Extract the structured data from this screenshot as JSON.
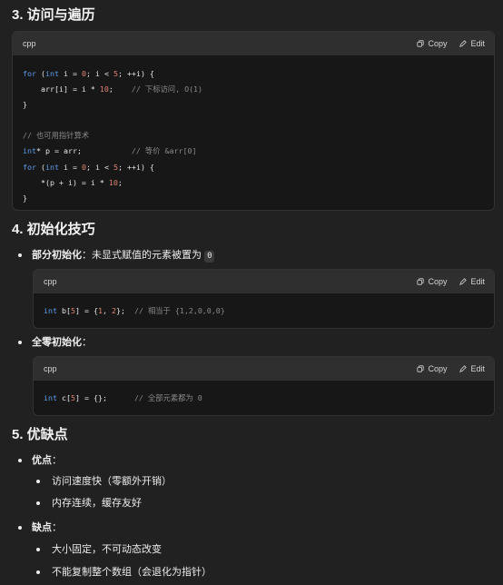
{
  "sections": {
    "access": {
      "heading": "3. 访问与遍历",
      "code": {
        "lang": "cpp",
        "copy_label": "Copy",
        "edit_label": "Edit",
        "lines": [
          [
            {
              "t": "kw",
              "s": "for"
            },
            {
              "t": "pl",
              "s": " ("
            },
            {
              "t": "kw",
              "s": "int"
            },
            {
              "t": "pl",
              "s": " i = "
            },
            {
              "t": "num",
              "s": "0"
            },
            {
              "t": "pl",
              "s": "; i < "
            },
            {
              "t": "num",
              "s": "5"
            },
            {
              "t": "pl",
              "s": "; ++i) {"
            }
          ],
          [
            {
              "t": "pl",
              "s": "    arr[i] = i * "
            },
            {
              "t": "num",
              "s": "10"
            },
            {
              "t": "pl",
              "s": ";    "
            },
            {
              "t": "cm",
              "s": "// 下标访问, O(1)"
            }
          ],
          [
            {
              "t": "pl",
              "s": "}"
            }
          ],
          [
            {
              "t": "pl",
              "s": ""
            }
          ],
          [
            {
              "t": "cm",
              "s": "// 也可用指针算术"
            }
          ],
          [
            {
              "t": "kw",
              "s": "int"
            },
            {
              "t": "pl",
              "s": "* p = arr;           "
            },
            {
              "t": "cm",
              "s": "// 等价 &arr[0]"
            }
          ],
          [
            {
              "t": "kw",
              "s": "for"
            },
            {
              "t": "pl",
              "s": " ("
            },
            {
              "t": "kw",
              "s": "int"
            },
            {
              "t": "pl",
              "s": " i = "
            },
            {
              "t": "num",
              "s": "0"
            },
            {
              "t": "pl",
              "s": "; i < "
            },
            {
              "t": "num",
              "s": "5"
            },
            {
              "t": "pl",
              "s": "; ++i) {"
            }
          ],
          [
            {
              "t": "pl",
              "s": "    *(p + i) = i * "
            },
            {
              "t": "num",
              "s": "10"
            },
            {
              "t": "pl",
              "s": ";"
            }
          ],
          [
            {
              "t": "pl",
              "s": "}"
            }
          ]
        ]
      }
    },
    "init": {
      "heading": "4. 初始化技巧",
      "partial": {
        "label": "部分初始化",
        "text": "：未显式赋值的元素被置为 ",
        "inline_code": "0",
        "code": {
          "lang": "cpp",
          "copy_label": "Copy",
          "edit_label": "Edit",
          "lines": [
            [
              {
                "t": "kw",
                "s": "int"
              },
              {
                "t": "pl",
                "s": " b["
              },
              {
                "t": "num",
                "s": "5"
              },
              {
                "t": "pl",
                "s": "] = {"
              },
              {
                "t": "num",
                "s": "1"
              },
              {
                "t": "pl",
                "s": ", "
              },
              {
                "t": "num",
                "s": "2"
              },
              {
                "t": "pl",
                "s": "};  "
              },
              {
                "t": "cm",
                "s": "// 相当于 {1,2,0,0,0}"
              }
            ]
          ]
        }
      },
      "zero": {
        "label": "全零初始化",
        "text": "：",
        "code": {
          "lang": "cpp",
          "copy_label": "Copy",
          "edit_label": "Edit",
          "lines": [
            [
              {
                "t": "kw",
                "s": "int"
              },
              {
                "t": "pl",
                "s": " c["
              },
              {
                "t": "num",
                "s": "5"
              },
              {
                "t": "pl",
                "s": "] = {};      "
              },
              {
                "t": "cm",
                "s": "// 全部元素都为 0"
              }
            ]
          ]
        }
      }
    },
    "proscons": {
      "heading": "5. 优缺点",
      "pros": {
        "label": "优点",
        "text": "：",
        "items": [
          "访问速度快（零额外开销）",
          "内存连续，缓存友好"
        ]
      },
      "cons": {
        "label": "缺点",
        "text": "：",
        "items": [
          "大小固定，不可动态改变",
          "不能复制整个数组（会退化为指针）"
        ]
      }
    }
  }
}
